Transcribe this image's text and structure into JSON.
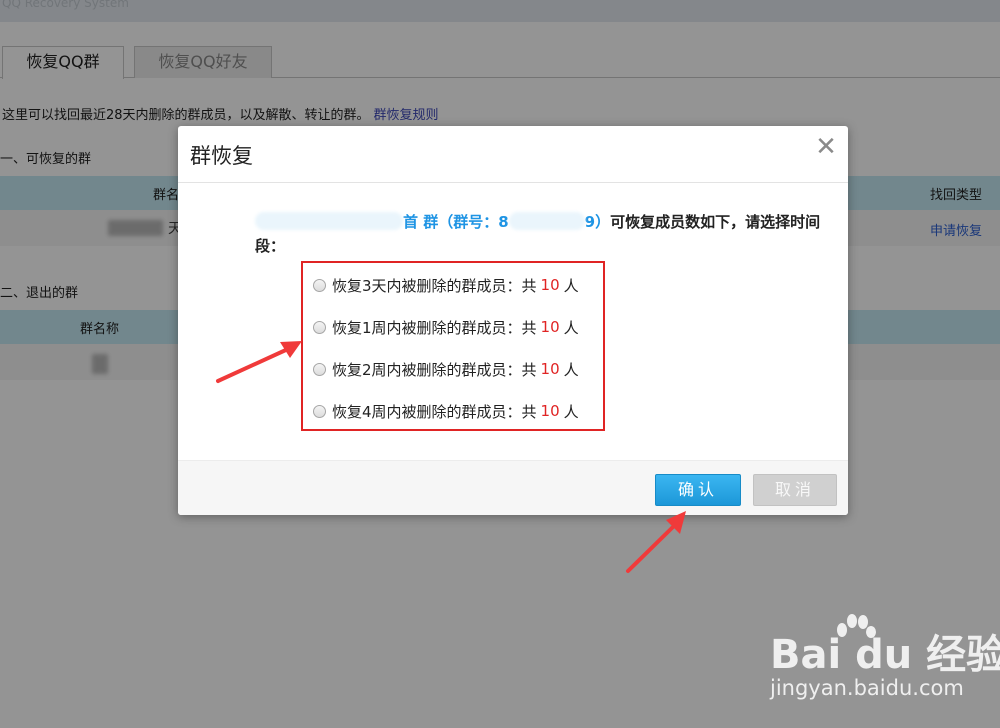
{
  "app": {
    "system_title": "QQ Recovery System"
  },
  "tabs": [
    {
      "label": "恢复QQ群",
      "active": true
    },
    {
      "label": "恢复QQ好友",
      "active": false
    }
  ],
  "page": {
    "description": "这里可以找回最近28天内删除的群成员，以及解散、转让的群。",
    "rules_link": "群恢复规则",
    "section1_title": "一、可恢复的群",
    "section1_headers": [
      "群名",
      "找回类型"
    ],
    "section1_row": {
      "blurred_suffix": "天",
      "action": "申请恢复"
    },
    "section2_title": "二、退出的群",
    "section2_headers": [
      "群名称"
    ]
  },
  "dialog": {
    "title": "群恢复",
    "message_group_suffix": "首 群（群号：8",
    "message_number_suffix": "9）",
    "message_tail": "可恢复成员数如下，请选择时间段：",
    "options": [
      {
        "prefix": "恢复3天内被删除的群成员：共",
        "count": "10",
        "unit": "人"
      },
      {
        "prefix": "恢复1周内被删除的群成员：共",
        "count": "10",
        "unit": "人"
      },
      {
        "prefix": "恢复2周内被删除的群成员：共",
        "count": "10",
        "unit": "人"
      },
      {
        "prefix": "恢复4周内被删除的群成员：共",
        "count": "10",
        "unit": "人"
      }
    ],
    "confirm_label": "确认",
    "cancel_label": "取消"
  },
  "watermark": {
    "brand": "Bai du 经验",
    "url": "jingyan.baidu.com"
  },
  "colors": {
    "accent_blue": "#1c97d8",
    "highlight_red": "#e02424",
    "table_header": "#c5e8f3",
    "link_blue": "#2b5fd1"
  }
}
